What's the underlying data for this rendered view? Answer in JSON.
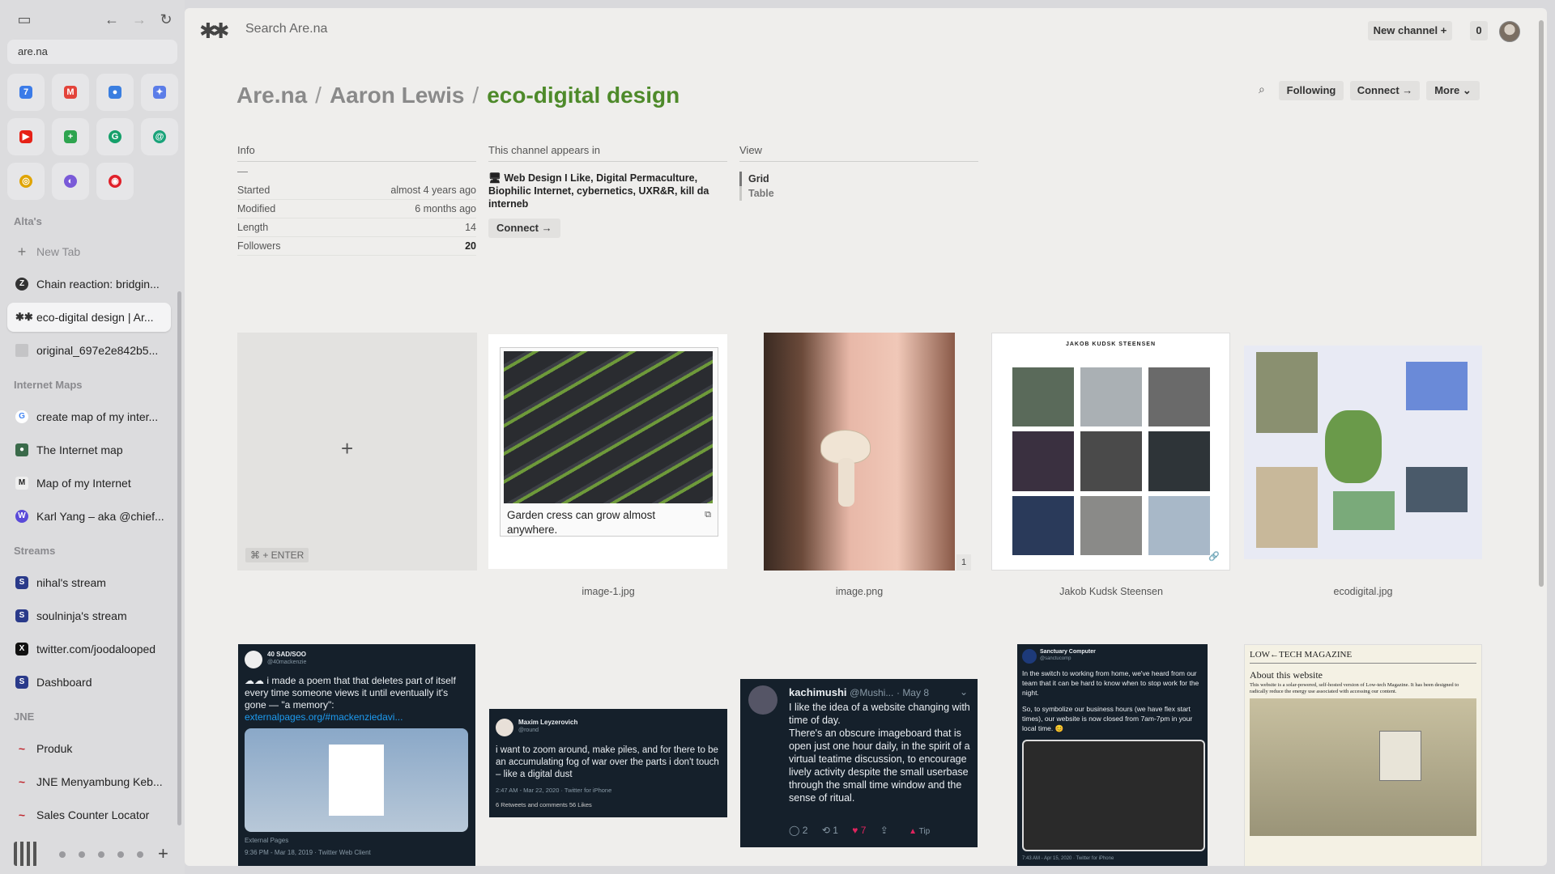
{
  "browser": {
    "url": "are.na",
    "pinned": [
      {
        "icon": "calendar-icon",
        "color": "#3b7be8",
        "glyph": "7"
      },
      {
        "icon": "gmail-icon",
        "color": "#e3433a",
        "glyph": "M"
      },
      {
        "icon": "cloud-icon",
        "color": "#3a7ee0",
        "glyph": "●"
      },
      {
        "icon": "sparkle-icon",
        "color": "#5b7de8",
        "glyph": "✦"
      },
      {
        "icon": "youtube-icon",
        "color": "#e62117",
        "glyph": "▶"
      },
      {
        "icon": "plus-square-icon",
        "color": "#2ea44f",
        "glyph": "+"
      },
      {
        "icon": "grammarly-icon",
        "color": "#15a06a",
        "glyph": "G"
      },
      {
        "icon": "at-icon",
        "color": "#1aa37a",
        "glyph": "@"
      },
      {
        "icon": "coin-icon",
        "color": "#e0a400",
        "glyph": "◎"
      },
      {
        "icon": "orbit-icon",
        "color": "#7a5ad8",
        "glyph": "◐"
      },
      {
        "icon": "record-icon",
        "color": "#e0202a",
        "glyph": "◉"
      }
    ],
    "sections": {
      "altas": "Alta's",
      "internet_maps": "Internet Maps",
      "streams": "Streams",
      "jne": "JNE"
    },
    "new_tab": "New Tab",
    "tabs": [
      {
        "label": "Chain reaction: bridgin...",
        "icon": "z-icon",
        "color": "#333",
        "glyph": "Z"
      },
      {
        "label": "eco-digital design | Ar...",
        "icon": "arena-icon",
        "color": "#efeeec",
        "glyph": "✱"
      },
      {
        "label": "original_697e2e842b5...",
        "icon": "image-icon",
        "color": "#c8c8c8",
        "glyph": ""
      },
      {
        "label": "create map of my inter...",
        "icon": "google-icon",
        "color": "#fff",
        "glyph": "G"
      },
      {
        "label": "The Internet map",
        "icon": "globe-icon",
        "color": "#3a6a4a",
        "glyph": "●"
      },
      {
        "label": "Map of my Internet",
        "icon": "medium-icon",
        "color": "#eee",
        "glyph": "M"
      },
      {
        "label": "Karl Yang – aka @chief...",
        "icon": "webring-icon",
        "color": "#5a4ad8",
        "glyph": "W"
      },
      {
        "label": "nihal's stream",
        "icon": "s-icon",
        "color": "#2a3a8a",
        "glyph": "S"
      },
      {
        "label": "soulninja's stream",
        "icon": "s-icon",
        "color": "#2a3a8a",
        "glyph": "S"
      },
      {
        "label": "twitter.com/joodalooped",
        "icon": "x-icon",
        "color": "#111",
        "glyph": "X"
      },
      {
        "label": "Dashboard",
        "icon": "s-icon",
        "color": "#2a3a8a",
        "glyph": "S"
      },
      {
        "label": "Produk",
        "icon": "jne-icon",
        "color": "#d8dce8",
        "glyph": "~"
      },
      {
        "label": "JNE Menyambung Keb...",
        "icon": "jne-icon",
        "color": "#d8dce8",
        "glyph": "~"
      },
      {
        "label": "Sales Counter Locator",
        "icon": "jne-icon",
        "color": "#d8dce8",
        "glyph": "~"
      }
    ]
  },
  "arena": {
    "search_placeholder": "Search Are.na",
    "new_channel": "New channel",
    "notification_count": "0",
    "breadcrumb": [
      "Are.na",
      "Aaron Lewis",
      "eco-digital design"
    ],
    "header_buttons": {
      "following": "Following",
      "connect": "Connect →",
      "more": "More"
    },
    "info": {
      "heading": "Info",
      "dash": "—",
      "rows": [
        {
          "k": "Started",
          "v": "almost 4 years ago"
        },
        {
          "k": "Modified",
          "v": "6 months ago"
        },
        {
          "k": "Length",
          "v": "14"
        },
        {
          "k": "Followers",
          "v": "20"
        }
      ]
    },
    "appears": {
      "heading": "This channel appears in",
      "p1": "Web Design I Like",
      "p2": "Digital Permaculture",
      "p3": "Biophilic Internet",
      "p4": "cybernetics",
      "p5": "UXR&R",
      "p6": "kill da interneb",
      "connect": "Connect →"
    },
    "view": {
      "heading": "View",
      "grid": "Grid",
      "table": "Table"
    },
    "add_hint": "⌘ + ENTER",
    "blocks": {
      "b1_caption": "Garden cress can grow almost anywhere.",
      "b1_title": "image-1.jpg",
      "b2_title": "image.png",
      "b2_count": "1",
      "b3_title": "Jakob Kudsk Steensen",
      "b3_header": "JAKOB KUDSK STEENSEN",
      "b4_title": "ecodigital.jpg"
    },
    "tweets": {
      "t1": {
        "name": "40 SAD/SOO",
        "handle": "@40mackenzie",
        "text": "i made a poem that that deletes part of itself every time someone views it until eventually it's gone — \"a memory\":",
        "link": "externalpages.org/#mackenziedavi...",
        "foot": "9:36 PM - Mar 18, 2019 · Twitter Web Client",
        "card": "External Pages"
      },
      "t2": {
        "name": "Maxim Leyzerovich",
        "handle": "@round",
        "text": "i want to zoom around, make piles, and for there to be an accumulating fog of war over the parts i don't touch – like a digital dust",
        "foot": "2:47 AM - Mar 22, 2020 · Twitter for iPhone",
        "stats": "6 Retweets and comments   56 Likes"
      },
      "t3": {
        "name": "kachimushi",
        "handle": "@Mushi...",
        "date": "· May 8",
        "text1": "I like the idea of a website changing with time of day.",
        "text2": "There's an obscure imageboard that is open just one hour daily, in the spirit of a virtual teatime discussion, to encourage lively activity despite the small userbase through the small time window and the sense of ritual.",
        "replies": "2",
        "retweets": "1",
        "likes": "7",
        "tip": "Tip"
      },
      "t4": {
        "name": "Sanctuary Computer",
        "handle": "@sanctucomp",
        "text1": "In the switch to working from home, we've heard from our team that it can be hard to know when to stop work for the night.",
        "text2": "So, to symbolize our business hours (we have flex start times), our website is now closed from 7am-7pm in your local time. 😊",
        "foot": "7:43 AM - Apr 15, 2020 · Twitter for iPhone"
      }
    },
    "lowtech": {
      "title": "LOW←TECH MAGAZINE",
      "heading": "About this website",
      "body": "This website is a solar-powered, self-hosted version of Low-tech Magazine. It has been designed to radically reduce the energy use associated with accessing our content."
    }
  }
}
